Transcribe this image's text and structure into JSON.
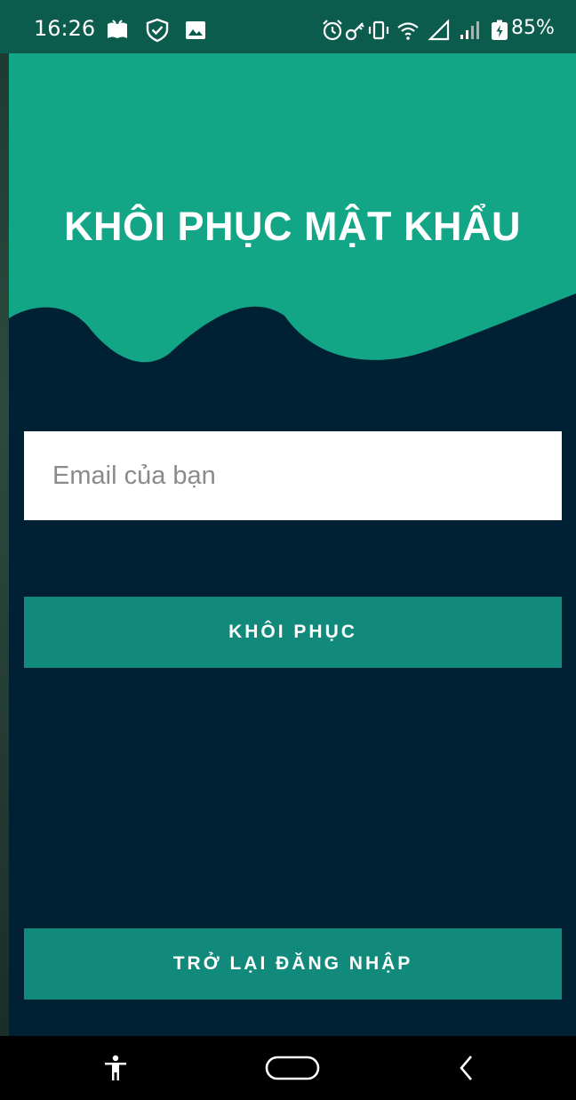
{
  "status_bar": {
    "time": "16:26",
    "battery": "85%",
    "icons": [
      "book-icon",
      "shield-icon",
      "image-icon",
      "alarm-icon",
      "key-icon",
      "vibrate-icon",
      "wifi-icon",
      "signal-triangle-icon",
      "signal-bars-icon",
      "battery-icon"
    ]
  },
  "header": {
    "title": "KHÔI PHỤC MẬT KHẨU"
  },
  "form": {
    "email_placeholder": "Email của bạn",
    "email_value": ""
  },
  "buttons": {
    "restore_label": "KHÔI PHỤC",
    "back_label": "TRỞ LẠI ĐĂNG NHẬP"
  },
  "nav_bar": {
    "icons": [
      "accessibility-icon",
      "home-pill-icon",
      "back-chevron-icon"
    ]
  },
  "colors": {
    "status_bar": "#0c5c4e",
    "header_teal": "#12a586",
    "background_navy": "#002133",
    "button": "#118a7c",
    "input": "#ffffff",
    "nav_bar": "#000000"
  }
}
